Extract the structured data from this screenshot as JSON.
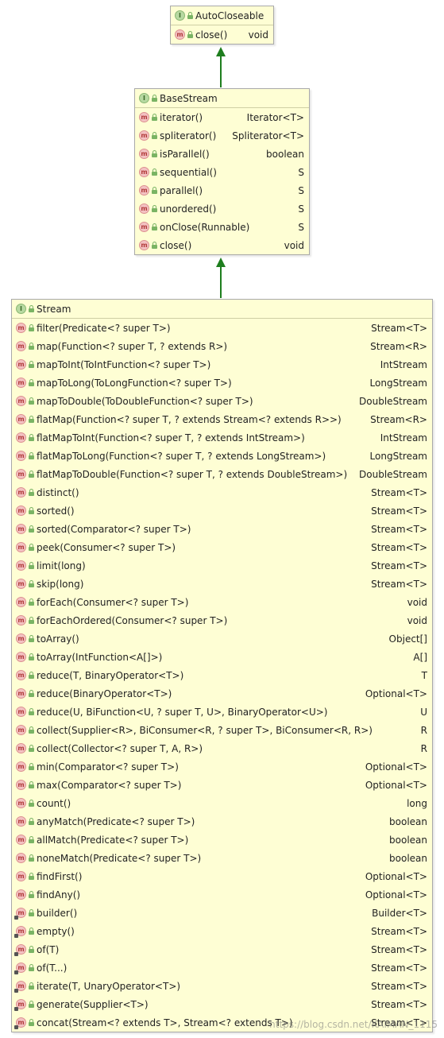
{
  "autocloseable": {
    "badge": "I",
    "title": "AutoCloseable",
    "methods": [
      {
        "sig": "close()",
        "ret": "void",
        "static": false
      }
    ]
  },
  "basestream": {
    "badge": "I",
    "title": "BaseStream",
    "methods": [
      {
        "sig": "iterator()",
        "ret": "Iterator<T>",
        "static": false
      },
      {
        "sig": "spliterator()",
        "ret": "Spliterator<T>",
        "static": false
      },
      {
        "sig": "isParallel()",
        "ret": "boolean",
        "static": false
      },
      {
        "sig": "sequential()",
        "ret": "S",
        "static": false
      },
      {
        "sig": "parallel()",
        "ret": "S",
        "static": false
      },
      {
        "sig": "unordered()",
        "ret": "S",
        "static": false
      },
      {
        "sig": "onClose(Runnable)",
        "ret": "S",
        "static": false
      },
      {
        "sig": "close()",
        "ret": "void",
        "static": false
      }
    ]
  },
  "stream": {
    "badge": "I",
    "title": "Stream",
    "methods": [
      {
        "sig": "filter(Predicate<? super T>)",
        "ret": "Stream<T>",
        "static": false
      },
      {
        "sig": "map(Function<? super T, ? extends R>)",
        "ret": "Stream<R>",
        "static": false
      },
      {
        "sig": "mapToInt(ToIntFunction<? super T>)",
        "ret": "IntStream",
        "static": false
      },
      {
        "sig": "mapToLong(ToLongFunction<? super T>)",
        "ret": "LongStream",
        "static": false
      },
      {
        "sig": "mapToDouble(ToDoubleFunction<? super T>)",
        "ret": "DoubleStream",
        "static": false
      },
      {
        "sig": "flatMap(Function<? super T, ? extends Stream<? extends R>>)",
        "ret": "Stream<R>",
        "static": false
      },
      {
        "sig": "flatMapToInt(Function<? super T, ? extends IntStream>)",
        "ret": "IntStream",
        "static": false
      },
      {
        "sig": "flatMapToLong(Function<? super T, ? extends LongStream>)",
        "ret": "LongStream",
        "static": false
      },
      {
        "sig": "flatMapToDouble(Function<? super T, ? extends DoubleStream>)",
        "ret": "DoubleStream",
        "static": false
      },
      {
        "sig": "distinct()",
        "ret": "Stream<T>",
        "static": false
      },
      {
        "sig": "sorted()",
        "ret": "Stream<T>",
        "static": false
      },
      {
        "sig": "sorted(Comparator<? super T>)",
        "ret": "Stream<T>",
        "static": false
      },
      {
        "sig": "peek(Consumer<? super T>)",
        "ret": "Stream<T>",
        "static": false
      },
      {
        "sig": "limit(long)",
        "ret": "Stream<T>",
        "static": false
      },
      {
        "sig": "skip(long)",
        "ret": "Stream<T>",
        "static": false
      },
      {
        "sig": "forEach(Consumer<? super T>)",
        "ret": "void",
        "static": false
      },
      {
        "sig": "forEachOrdered(Consumer<? super T>)",
        "ret": "void",
        "static": false
      },
      {
        "sig": "toArray()",
        "ret": "Object[]",
        "static": false
      },
      {
        "sig": "toArray(IntFunction<A[]>)",
        "ret": "A[]",
        "static": false
      },
      {
        "sig": "reduce(T, BinaryOperator<T>)",
        "ret": "T",
        "static": false
      },
      {
        "sig": "reduce(BinaryOperator<T>)",
        "ret": "Optional<T>",
        "static": false
      },
      {
        "sig": "reduce(U, BiFunction<U, ? super T, U>, BinaryOperator<U>)",
        "ret": "U",
        "static": false
      },
      {
        "sig": "collect(Supplier<R>, BiConsumer<R, ? super T>, BiConsumer<R, R>)",
        "ret": "R",
        "static": false
      },
      {
        "sig": "collect(Collector<? super T, A, R>)",
        "ret": "R",
        "static": false
      },
      {
        "sig": "min(Comparator<? super T>)",
        "ret": "Optional<T>",
        "static": false
      },
      {
        "sig": "max(Comparator<? super T>)",
        "ret": "Optional<T>",
        "static": false
      },
      {
        "sig": "count()",
        "ret": "long",
        "static": false
      },
      {
        "sig": "anyMatch(Predicate<? super T>)",
        "ret": "boolean",
        "static": false
      },
      {
        "sig": "allMatch(Predicate<? super T>)",
        "ret": "boolean",
        "static": false
      },
      {
        "sig": "noneMatch(Predicate<? super T>)",
        "ret": "boolean",
        "static": false
      },
      {
        "sig": "findFirst()",
        "ret": "Optional<T>",
        "static": false
      },
      {
        "sig": "findAny()",
        "ret": "Optional<T>",
        "static": false
      },
      {
        "sig": "builder()",
        "ret": "Builder<T>",
        "static": true
      },
      {
        "sig": "empty()",
        "ret": "Stream<T>",
        "static": true
      },
      {
        "sig": "of(T)",
        "ret": "Stream<T>",
        "static": true
      },
      {
        "sig": "of(T...)",
        "ret": "Stream<T>",
        "static": true
      },
      {
        "sig": "iterate(T, UnaryOperator<T>)",
        "ret": "Stream<T>",
        "static": true
      },
      {
        "sig": "generate(Supplier<T>)",
        "ret": "Stream<T>",
        "static": true
      },
      {
        "sig": "concat(Stream<? extends T>, Stream<? extends T>)",
        "ret": "Stream<T>",
        "static": true
      }
    ]
  },
  "method_badge": "m",
  "watermark": "https://blog.csdn.net/KAIMAN_1115",
  "colors": {
    "box_bg": "#fefed4",
    "arrow": "#1e7e1e",
    "interface_badge": "#b7d9a1",
    "method_badge": "#f3c2c2"
  }
}
